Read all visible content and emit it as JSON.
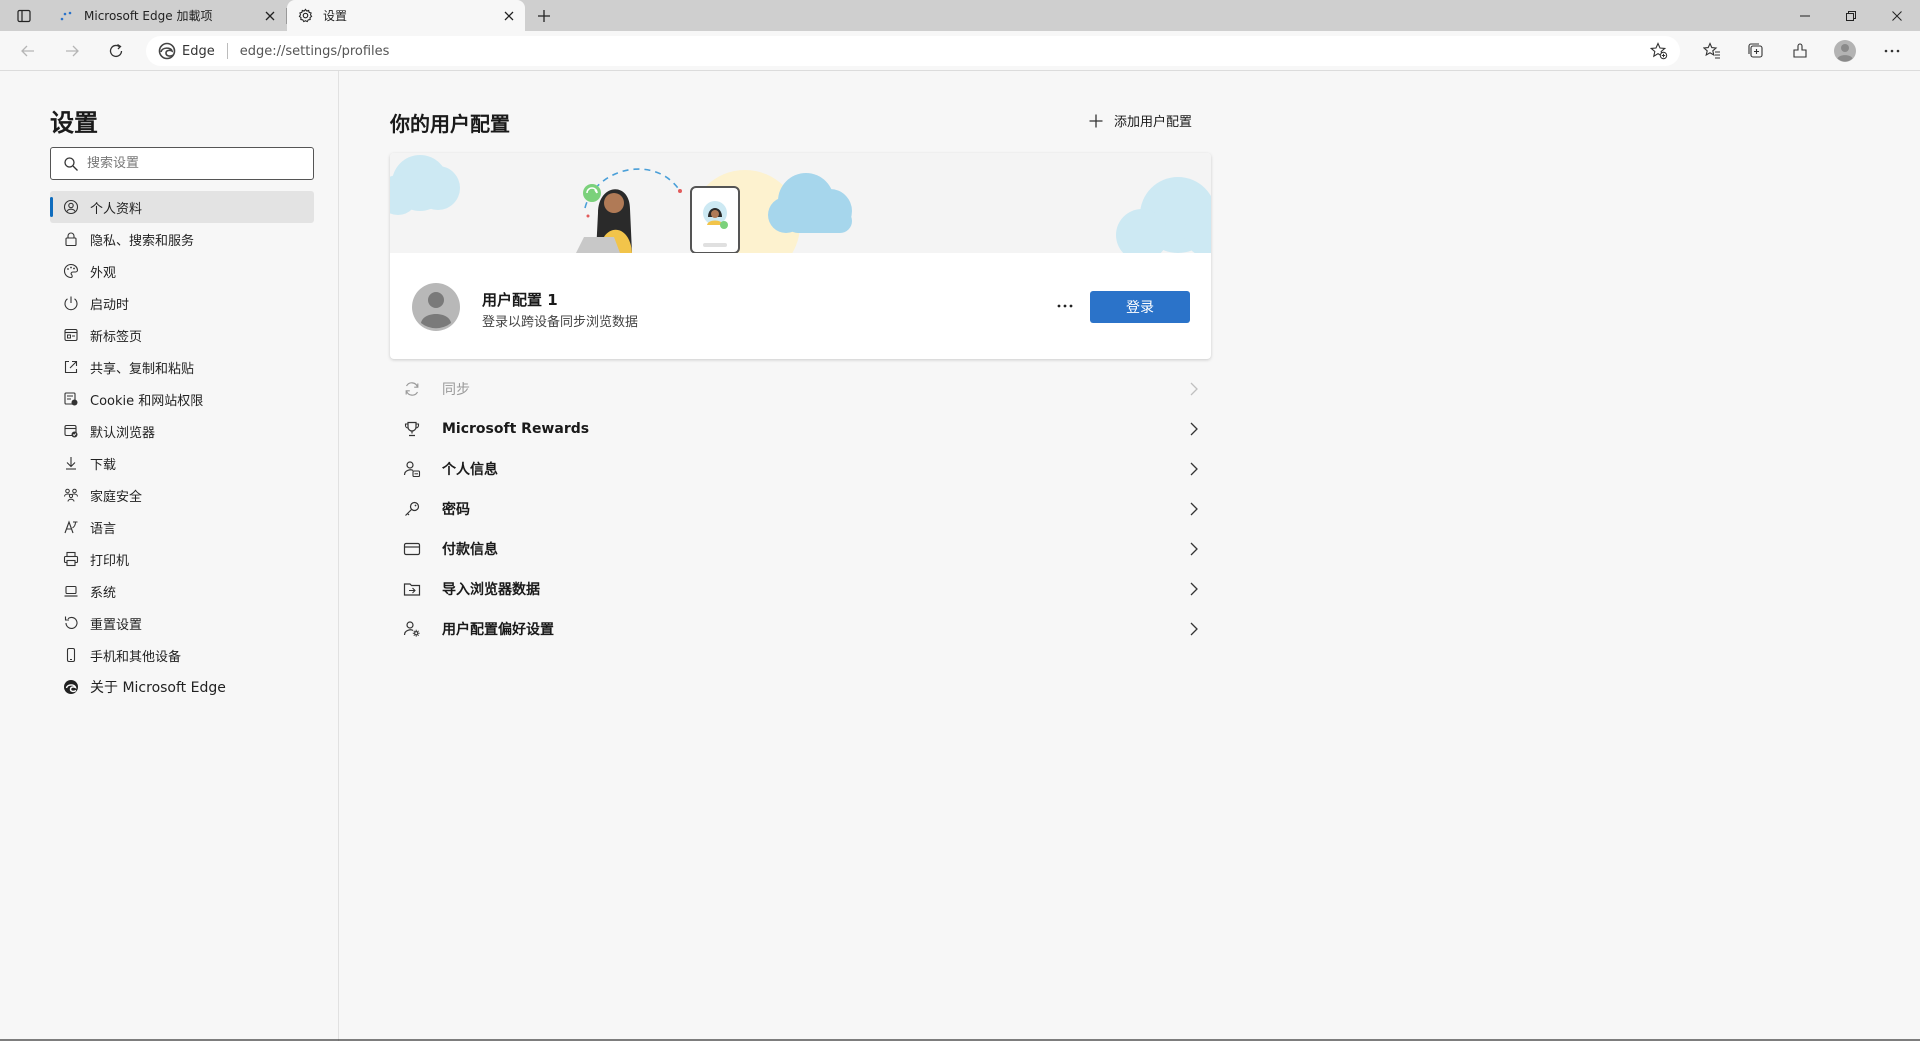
{
  "tabs": [
    {
      "title": "Microsoft Edge 加載项",
      "active": false
    },
    {
      "title": "设置",
      "active": true
    }
  ],
  "toolbar": {
    "site_name": "Edge",
    "url": "edge://settings/profiles"
  },
  "sidebar": {
    "title": "设置",
    "search_placeholder": "搜索设置",
    "items": [
      {
        "label": "个人资料",
        "icon": "profile-icon",
        "active": true
      },
      {
        "label": "隐私、搜索和服务",
        "icon": "lock-icon"
      },
      {
        "label": "外观",
        "icon": "appearance-icon"
      },
      {
        "label": "启动时",
        "icon": "power-icon"
      },
      {
        "label": "新标签页",
        "icon": "newtab-icon"
      },
      {
        "label": "共享、复制和粘贴",
        "icon": "share-icon"
      },
      {
        "label": "Cookie 和网站权限",
        "icon": "cookie-icon"
      },
      {
        "label": "默认浏览器",
        "icon": "default-browser-icon"
      },
      {
        "label": "下载",
        "icon": "download-icon"
      },
      {
        "label": "家庭安全",
        "icon": "family-icon"
      },
      {
        "label": "语言",
        "icon": "language-icon"
      },
      {
        "label": "打印机",
        "icon": "printer-icon"
      },
      {
        "label": "系统",
        "icon": "system-icon"
      },
      {
        "label": "重置设置",
        "icon": "reset-icon"
      },
      {
        "label": "手机和其他设备",
        "icon": "phone-icon"
      },
      {
        "label": "关于 Microsoft Edge",
        "icon": "edge-icon"
      }
    ]
  },
  "main": {
    "title": "你的用户配置",
    "add_profile": "添加用户配置",
    "profile": {
      "name": "用户配置 1",
      "subtitle": "登录以跨设备同步浏览数据",
      "signin_label": "登录"
    },
    "settings": [
      {
        "label": "同步",
        "icon": "sync-icon",
        "disabled": true
      },
      {
        "label": "Microsoft Rewards",
        "icon": "trophy-icon"
      },
      {
        "label": "个人信息",
        "icon": "personal-info-icon"
      },
      {
        "label": "密码",
        "icon": "key-icon"
      },
      {
        "label": "付款信息",
        "icon": "card-icon"
      },
      {
        "label": "导入浏览器数据",
        "icon": "import-icon"
      },
      {
        "label": "用户配置偏好设置",
        "icon": "profile-prefs-icon"
      }
    ]
  },
  "colors": {
    "accent": "#2b73c9",
    "active_indicator": "#0f6cbd"
  }
}
